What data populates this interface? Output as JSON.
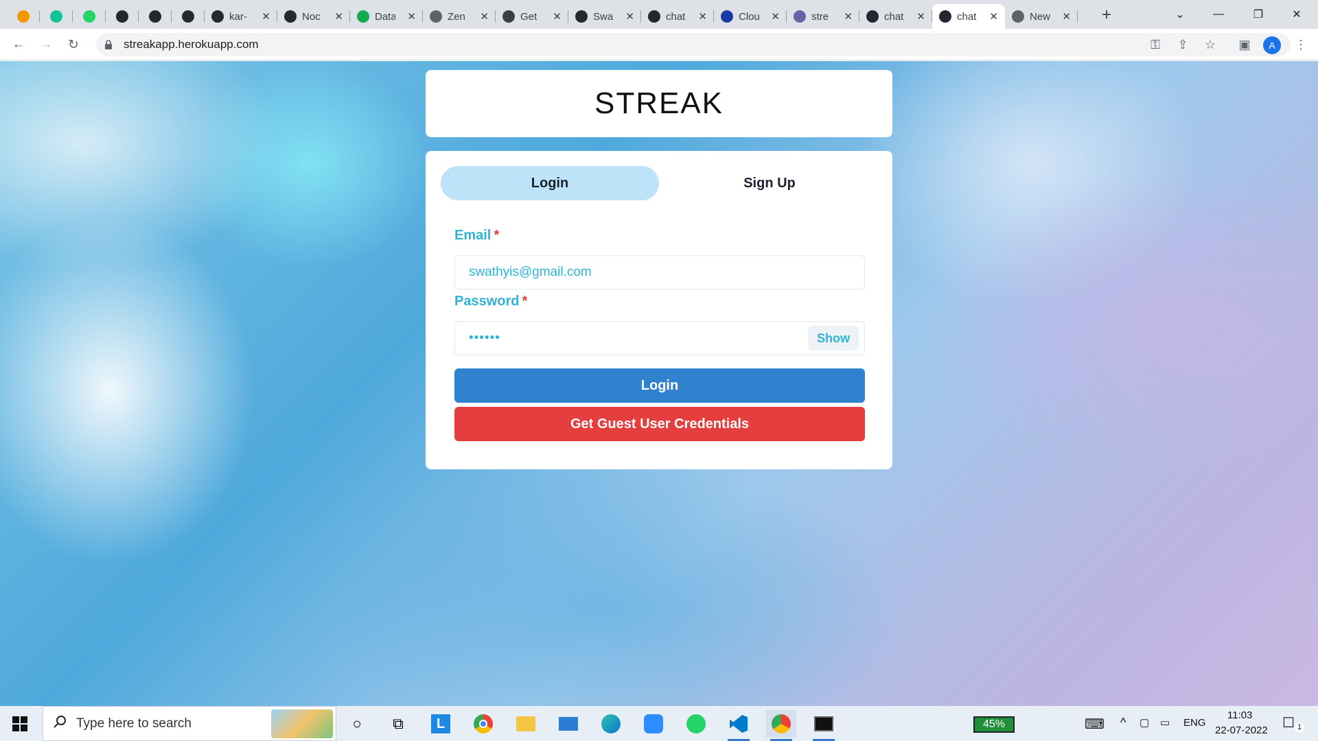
{
  "browser": {
    "tabs": [
      {
        "title": "",
        "pinned": true,
        "icon": "clock-icon",
        "color": "#f29900"
      },
      {
        "title": "",
        "pinned": true,
        "icon": "grammarly-icon",
        "color": "#15c39a"
      },
      {
        "title": "",
        "pinned": true,
        "icon": "whatsapp-icon",
        "color": "#25d366"
      },
      {
        "title": "",
        "pinned": true,
        "icon": "github-icon",
        "color": "#24292e"
      },
      {
        "title": "",
        "pinned": true,
        "icon": "github-icon",
        "color": "#24292e"
      },
      {
        "title": "",
        "pinned": true,
        "icon": "github-icon",
        "color": "#24292e"
      },
      {
        "title": "kar-",
        "icon": "github-icon",
        "color": "#24292e"
      },
      {
        "title": "Noc",
        "icon": "github-icon",
        "color": "#24292e"
      },
      {
        "title": "Data",
        "icon": "mongodb-icon",
        "color": "#13aa52"
      },
      {
        "title": "Zen",
        "icon": "page-icon",
        "color": "#5f6368"
      },
      {
        "title": "Get",
        "icon": "compass-icon",
        "color": "#3c4043"
      },
      {
        "title": "Swa",
        "icon": "github-icon",
        "color": "#24292e"
      },
      {
        "title": "chat",
        "icon": "react-icon",
        "color": "#23272f"
      },
      {
        "title": "Clou",
        "icon": "cloud-icon",
        "color": "#1a3ca3"
      },
      {
        "title": "stre",
        "icon": "heroku-icon",
        "color": "#6762a6"
      },
      {
        "title": "chat",
        "icon": "react-icon",
        "color": "#23272f"
      },
      {
        "title": "chat",
        "icon": "react-icon",
        "color": "#23272f",
        "active": true
      },
      {
        "title": "New",
        "icon": "globe-icon",
        "color": "#5f6368"
      }
    ],
    "url": "streakapp.herokuapp.com",
    "profile_initial": "A"
  },
  "page": {
    "brand": "STREAK",
    "tabs": {
      "login": "Login",
      "signup": "Sign Up"
    },
    "email": {
      "label": "Email",
      "required_mark": "*",
      "value": "swathyis@gmail.com"
    },
    "password": {
      "label": "Password",
      "required_mark": "*",
      "value": "••••••",
      "show_label": "Show"
    },
    "login_button": "Login",
    "guest_button": "Get Guest User Credentials"
  },
  "taskbar": {
    "search_placeholder": "Type here to search",
    "battery": "45%",
    "language": "ENG",
    "time": "11:03",
    "date": "22-07-2022",
    "notification_count": "1"
  },
  "colors": {
    "accent_label": "#2eb4d6",
    "login_button": "#3182ce",
    "guest_button": "#e53e3e",
    "active_tab": "#bee3f8"
  }
}
